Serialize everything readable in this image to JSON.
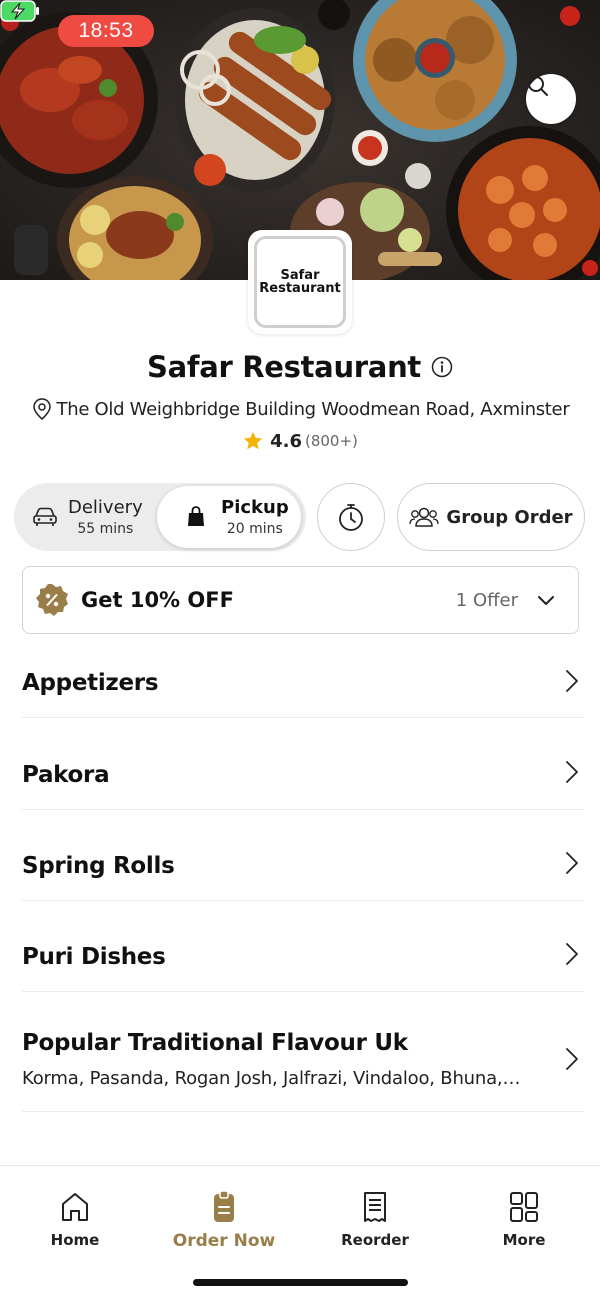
{
  "status_bar": {
    "time": "18:53"
  },
  "restaurant": {
    "logo_text": "Safar Restaurant",
    "name": "Safar Restaurant",
    "address": "The Old Weighbridge Building Woodmean Road, Axminster",
    "rating": "4.6",
    "rating_count": "(800+)"
  },
  "order_mode": {
    "delivery": {
      "label": "Delivery",
      "time": "55 mins"
    },
    "pickup": {
      "label": "Pickup",
      "time": "20 mins",
      "selected": true
    }
  },
  "group_order_label": "Group Order",
  "offer": {
    "title": "Get 10% OFF",
    "count": "1 Offer"
  },
  "categories": [
    {
      "name": "Appetizers"
    },
    {
      "name": "Pakora"
    },
    {
      "name": "Spring Rolls"
    },
    {
      "name": "Puri Dishes"
    },
    {
      "name": "Popular Traditional Flavour Uk",
      "description": "Korma, Pasanda, Rogan Josh, Jalfrazi, Vindaloo, Bhuna, Dopiaza"
    }
  ],
  "bottom_nav": [
    {
      "label": "Home",
      "icon": "home-icon"
    },
    {
      "label": "Order Now",
      "icon": "order-now-icon",
      "active": true
    },
    {
      "label": "Reorder",
      "icon": "receipt-icon"
    },
    {
      "label": "More",
      "icon": "grid-icon"
    }
  ],
  "colors": {
    "accent": "#9a7e4a",
    "time_pill": "#f04b43",
    "star": "#f4b400",
    "battery": "#4cd964"
  }
}
